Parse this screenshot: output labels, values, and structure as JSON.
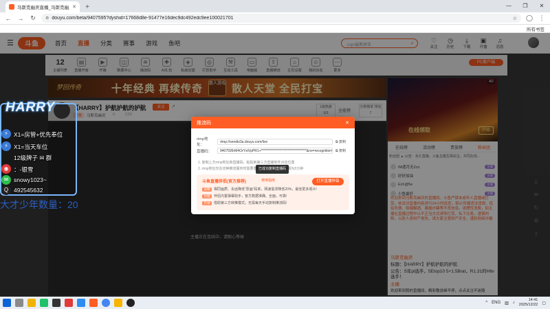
{
  "browser": {
    "tab_title": "马斯克幽灵直播_马斯克幽灵",
    "url": "douyu.com/beta/9407595?dyshid=17668d8e-91477e16dec9dc492edc9ee100021701",
    "bookmarks_all": "所有书签"
  },
  "site": {
    "logo": "斗鱼",
    "nav": [
      "首页",
      "直播",
      "分类",
      "赛事",
      "游戏",
      "鱼吧"
    ],
    "search_placeholder": "cspr最新拼车",
    "header_icons": [
      "关注",
      "历史",
      "下载",
      "开播",
      "消息"
    ]
  },
  "toolbar": {
    "follow_count": "12",
    "items": [
      "主播列表",
      "直播开房",
      "开播",
      "数据中心",
      "播流码",
      "AI礼包",
      "私房控盾",
      "打赏助手",
      "互动工具",
      "电脑版",
      "直播推流",
      "主页设置",
      "我的好友",
      "更多"
    ],
    "pc_button": "PC客户端"
  },
  "banner": {
    "left": "梦回传奇",
    "text1": "十年经典 再续传奇",
    "center": "散人游戏",
    "text2": "散人天堂 全民打宝"
  },
  "stream": {
    "title": "【HARRY】护航护航的护航",
    "hot": "46M",
    "follow": "关注",
    "tag": "斗鱼",
    "name": "马斯克幽灵",
    "meta1": "0",
    "meta2": "C52",
    "rank": "1级热度 0/3",
    "fullscreen": "全能榜",
    "card": "分类榜单 排名7",
    "connecting": "主播正在连线中，请耐心等候"
  },
  "sidebar": {
    "ad_text": "在线领取",
    "ad_btn": "开始",
    "tabs": [
      "在线榜",
      "活动榜",
      "贵族榜",
      "粉丝团"
    ],
    "notice": "粉丝团 ▲ 公告：永久直播。斗鱼主播互相关注，共同在线...",
    "ranks": [
      {
        "name": "IM遗月无Zzz",
        "badge": "主播"
      },
      {
        "name": "好好加油",
        "badge": "主播"
      },
      {
        "name": "Ech@5e",
        "badge": "主播"
      },
      {
        "name": "小鱼最好",
        "badge": "主播"
      }
    ],
    "welcome": "欢迎来到马斯克幽灵的直播间。斗鱼严禁未成年人直播或打赏，依法对直播内容进行24小时巡查，禁止传播违法违规、低俗色情、吸烟酗酒、暴露诈骗等不良信息。请理性消费，如主播在直播过程中以不正当方式诱导打赏，私下交易，谨慎判断，以防人身财产损失。请大家注意财产安全，谨防网络诈骗",
    "chat": [
      "马斯克幽灵",
      "标题：【HARRY】护航护航的护航",
      "公告：S年pl选手，5Etop10 5+1.5Brat，R1.31的Hltv选手！",
      "主播",
      "欢迎来到我的直播间，精彩敬说继不停，点点关注不迷路"
    ]
  },
  "modal": {
    "title": "推流码",
    "rtmp_label": "rtmp地址：",
    "rtmp_value": "rtmp://sendtx3a.douyu.com/live",
    "key_label": "直播码：",
    "key_value": "9407595rM4OrYxtVpPR1+**********************************&no=recognition=",
    "copy": "复制",
    "tip1": "1. 复制上方rtmp地址和直播码，粘贴到第三方直播软件对应位置",
    "tip2": "2. rtmp地址仅在切换推流服务时需要重新复制，直播码有效期为5分钟",
    "toast": "已成功复制直播码",
    "promo_title": "斗鱼直播伴侣(官方推荐)",
    "promo_tag": "使用指南",
    "promo_button": "打开直播伴侣",
    "promo_lines": [
      {
        "tag": "清晰",
        "text": "相同画质、永远降低“原画”码率，网速需求降低20%，最佳更多观众!"
      },
      {
        "tag": "功能",
        "text": "伴侣内置弹幕助手，官方数据准确、全面，可靠!"
      },
      {
        "tag": "方便",
        "text": "借助第三方转推模式，无需每天手动复制推流码!"
      }
    ]
  },
  "overlay": {
    "title": "HARRY",
    "lines": [
      {
        "icon": "⚡",
        "text": "X1=房管+优先奉位"
      },
      {
        "icon": "⚡",
        "text": "X1=当天车位"
      },
      {
        "icon": "",
        "text": "12级牌子 ✉ 群"
      },
      {
        "icon": "微",
        "text": "：-银雪"
      },
      {
        "icon": "微",
        "text": "snowy1023~"
      },
      {
        "icon": "Q",
        "text": "492545632"
      }
    ],
    "count": "大才少年数量：20"
  },
  "taskbar": {
    "lang": "ENG",
    "time": "14:41",
    "date": "2025/12/22"
  }
}
